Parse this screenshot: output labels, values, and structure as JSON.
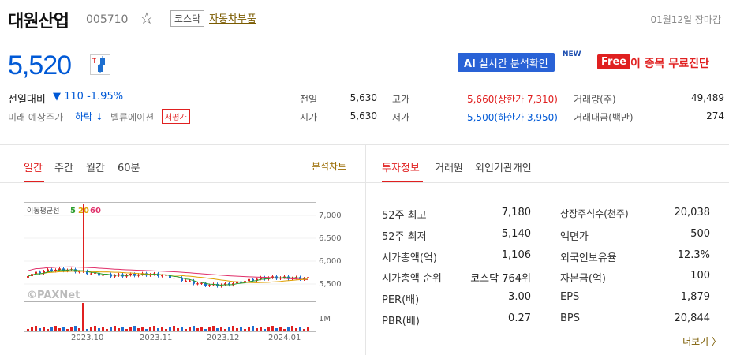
{
  "header": {
    "name": "대원산업",
    "code": "005710",
    "market": "코스닥",
    "sector": "자동차부품",
    "date": "01월12일 장마감",
    "star_icon": "star-outline-icon"
  },
  "price": {
    "current": "5,520",
    "change_label": "전일대비",
    "change_value": "▼ 110 -1.95%",
    "future_label": "미래 예상주가",
    "future_value": "하락 ↓",
    "valuation_label": "벨류에이션",
    "valuation_badge": "저평가"
  },
  "promo": {
    "ai_prefix": "AI",
    "ai_label": "실시간 분석확인",
    "new_tag": "NEW",
    "free_badge": "Free",
    "free_text": "이 종목 무료진단"
  },
  "quote": {
    "prev_label": "전일",
    "prev_value": "5,630",
    "open_label": "시가",
    "open_value": "5,630",
    "high_label": "고가",
    "high_value": "5,660(상한가 7,310)",
    "low_label": "저가",
    "low_value": "5,500(하한가 3,950)",
    "volume_label": "거래량(주)",
    "volume_value": "49,489",
    "amount_label": "거래대금(백만)",
    "amount_value": "274"
  },
  "chart_tabs": [
    "일간",
    "주간",
    "월간",
    "60분"
  ],
  "analysis_link": "분석차트",
  "info_tabs": [
    "투자정보",
    "거래원",
    "외인기관개인"
  ],
  "chart": {
    "ma_label": "이동평균선",
    "ma_5": "5",
    "ma_20": "20",
    "ma_60": "60",
    "watermark": "©PAXNet",
    "y_ticks": [
      "7,000",
      "6,500",
      "6,000",
      "5,500"
    ],
    "volume_tick": "1M",
    "x_ticks": [
      "2023.10",
      "2023.11",
      "2023.12",
      "2024.01"
    ],
    "colors": {
      "ma5": "#2a9d2a",
      "ma20": "#e0a000",
      "ma60": "#e0306a",
      "up": "#e02020",
      "down": "#1e6fd0"
    }
  },
  "info_left": [
    {
      "label": "52주 최고",
      "value": "7,180"
    },
    {
      "label": "52주 최저",
      "value": "5,140"
    },
    {
      "label": "시가총액(억)",
      "value": "1,106"
    },
    {
      "label": "시가총액 순위",
      "value": "코스닥 764위"
    },
    {
      "label": "PER(배)",
      "value": "3.00"
    },
    {
      "label": "PBR(배)",
      "value": "0.27"
    }
  ],
  "info_right": [
    {
      "label": "상장주식수(천주)",
      "value": "20,038"
    },
    {
      "label": "액면가",
      "value": "500"
    },
    {
      "label": "외국인보유율",
      "value": "12.3%"
    },
    {
      "label": "자본금(억)",
      "value": "100"
    },
    {
      "label": "EPS",
      "value": "1,879"
    },
    {
      "label": "BPS",
      "value": "20,844"
    }
  ],
  "more_link": "더보기 〉"
}
